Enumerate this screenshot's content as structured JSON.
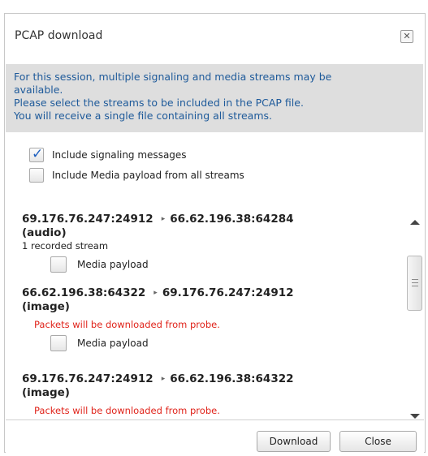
{
  "dialog": {
    "title": "PCAP download",
    "close_icon": "close-icon"
  },
  "info": {
    "lines": [
      "For this session, multiple signaling and media streams may be",
      "available.",
      "Please select the streams to be included in the PCAP file.",
      "You will receive a single file containing all streams."
    ]
  },
  "options": {
    "include_signaling": {
      "label": "Include signaling messages",
      "checked": true
    },
    "include_media": {
      "label": "Include Media payload from all streams",
      "checked": false
    }
  },
  "streams": [
    {
      "source": "69.176.76.247:24912",
      "destination": "66.62.196.38:64284",
      "type": "(audio)",
      "note": "1 recorded stream",
      "media_label": "Media payload",
      "media_checked": false
    },
    {
      "source": "66.62.196.38:64322",
      "destination": "69.176.76.247:24912",
      "type": "(image)",
      "warning": "Packets will be downloaded from probe.",
      "media_label": "Media payload",
      "media_checked": false
    },
    {
      "source": "69.176.76.247:24912",
      "destination": "66.62.196.38:64322",
      "type": "(image)",
      "warning": "Packets will be downloaded from probe."
    }
  ],
  "buttons": {
    "download": "Download",
    "close": "Close"
  },
  "colors": {
    "info_text": "#1e5a9a",
    "info_bg": "#dedede",
    "warning": "#e0241b"
  }
}
